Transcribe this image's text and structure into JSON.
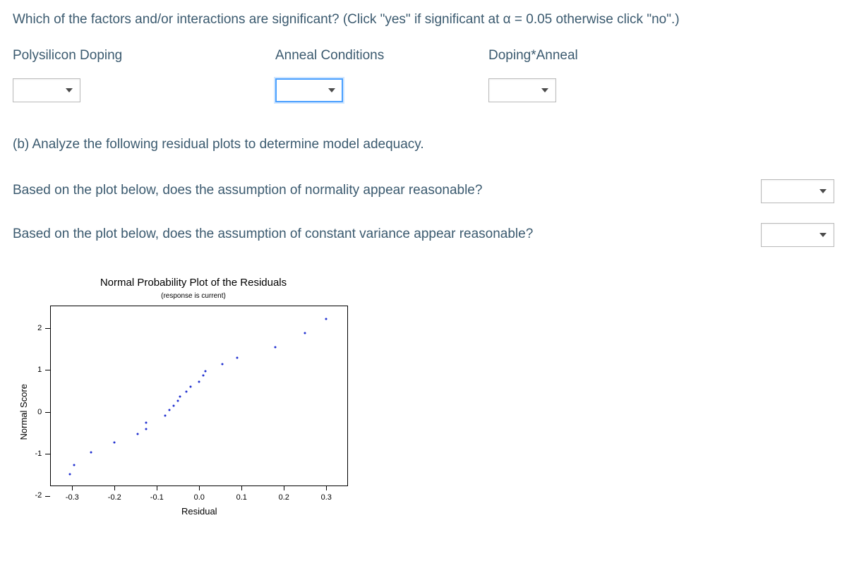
{
  "question": {
    "prompt": "Which of the factors and/or interactions are significant? (Click \"yes\" if significant at α = 0.05 otherwise click \"no\".)"
  },
  "factors": {
    "polysilicon": {
      "label": "Polysilicon Doping"
    },
    "anneal": {
      "label": "Anneal Conditions"
    },
    "interaction": {
      "label": "Doping*Anneal"
    }
  },
  "partb": {
    "heading": "(b) Analyze the following residual plots to determine model adequacy.",
    "normality": "Based on the plot below, does the assumption of normality appear reasonable?",
    "constant_variance": "Based on the plot below, does the assumption of constant variance appear reasonable?"
  },
  "chart_data": {
    "type": "scatter",
    "title": "Normal Probability Plot of the Residuals",
    "subtitle": "(response is current)",
    "xlabel": "Residual",
    "ylabel": "Normal Score",
    "xlim": [
      -0.35,
      0.35
    ],
    "ylim": [
      -2.2,
      2.2
    ],
    "xticks": [
      -0.3,
      -0.2,
      -0.1,
      0.0,
      0.1,
      0.2,
      0.3
    ],
    "yticks": [
      2,
      1,
      0,
      -1,
      -2
    ],
    "xtick_labels": [
      "-0.3",
      "-0.2",
      "-0.1",
      "0.0",
      "0.1",
      "0.2",
      "0.3"
    ],
    "ytick_labels": [
      "2",
      "1",
      "0",
      "-1",
      "-2"
    ],
    "series": [
      {
        "name": "residuals",
        "points": [
          {
            "x": -0.305,
            "y": -1.93
          },
          {
            "x": -0.295,
            "y": -1.7
          },
          {
            "x": -0.255,
            "y": -1.38
          },
          {
            "x": -0.2,
            "y": -1.15
          },
          {
            "x": -0.145,
            "y": -0.93
          },
          {
            "x": -0.125,
            "y": -0.82
          },
          {
            "x": -0.125,
            "y": -0.66
          },
          {
            "x": -0.08,
            "y": -0.48
          },
          {
            "x": -0.07,
            "y": -0.35
          },
          {
            "x": -0.06,
            "y": -0.24
          },
          {
            "x": -0.05,
            "y": -0.12
          },
          {
            "x": -0.045,
            "y": -0.02
          },
          {
            "x": -0.03,
            "y": 0.1
          },
          {
            "x": -0.02,
            "y": 0.22
          },
          {
            "x": 0.0,
            "y": 0.35
          },
          {
            "x": 0.01,
            "y": 0.5
          },
          {
            "x": 0.015,
            "y": 0.6
          },
          {
            "x": 0.055,
            "y": 0.78
          },
          {
            "x": 0.09,
            "y": 0.94
          },
          {
            "x": 0.18,
            "y": 1.2
          },
          {
            "x": 0.25,
            "y": 1.54
          },
          {
            "x": 0.3,
            "y": 1.88
          }
        ]
      }
    ]
  }
}
